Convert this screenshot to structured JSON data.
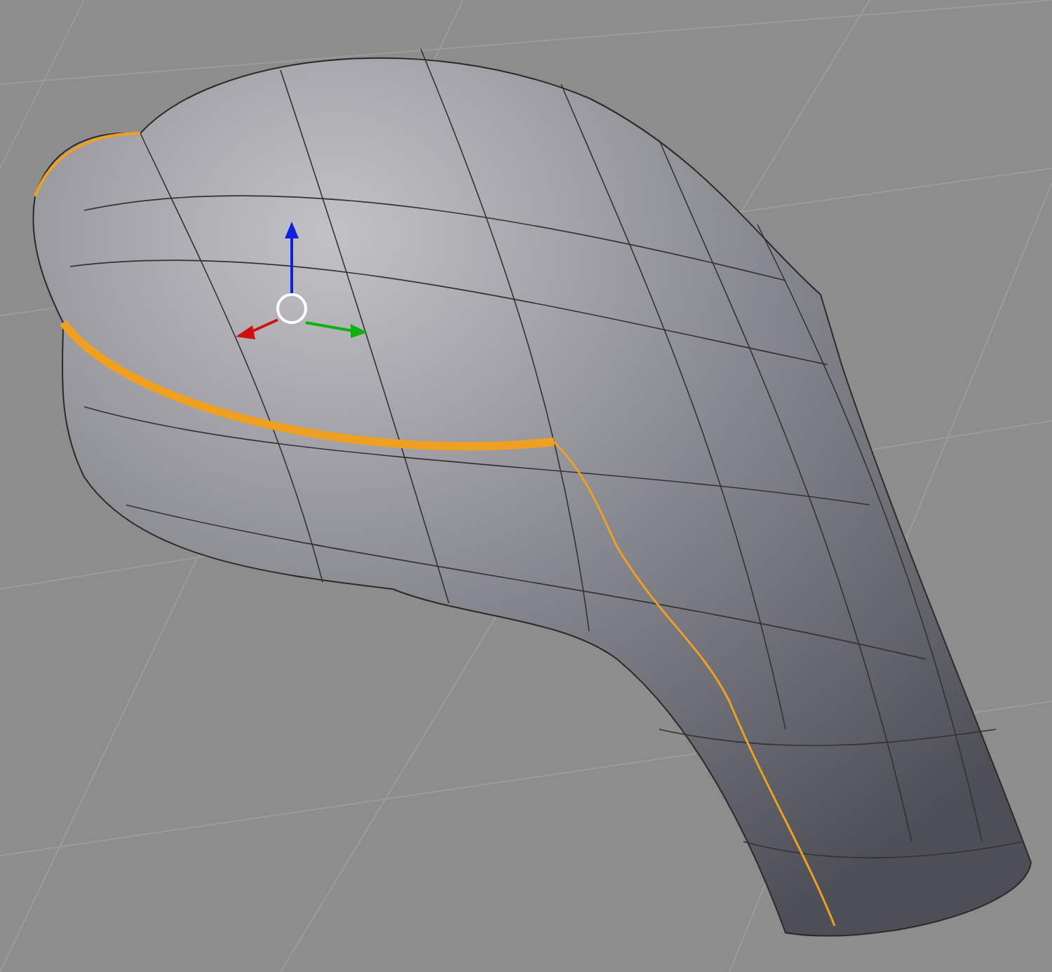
{
  "viewport": {
    "grid_visible": true,
    "manipulator_visible": true
  }
}
